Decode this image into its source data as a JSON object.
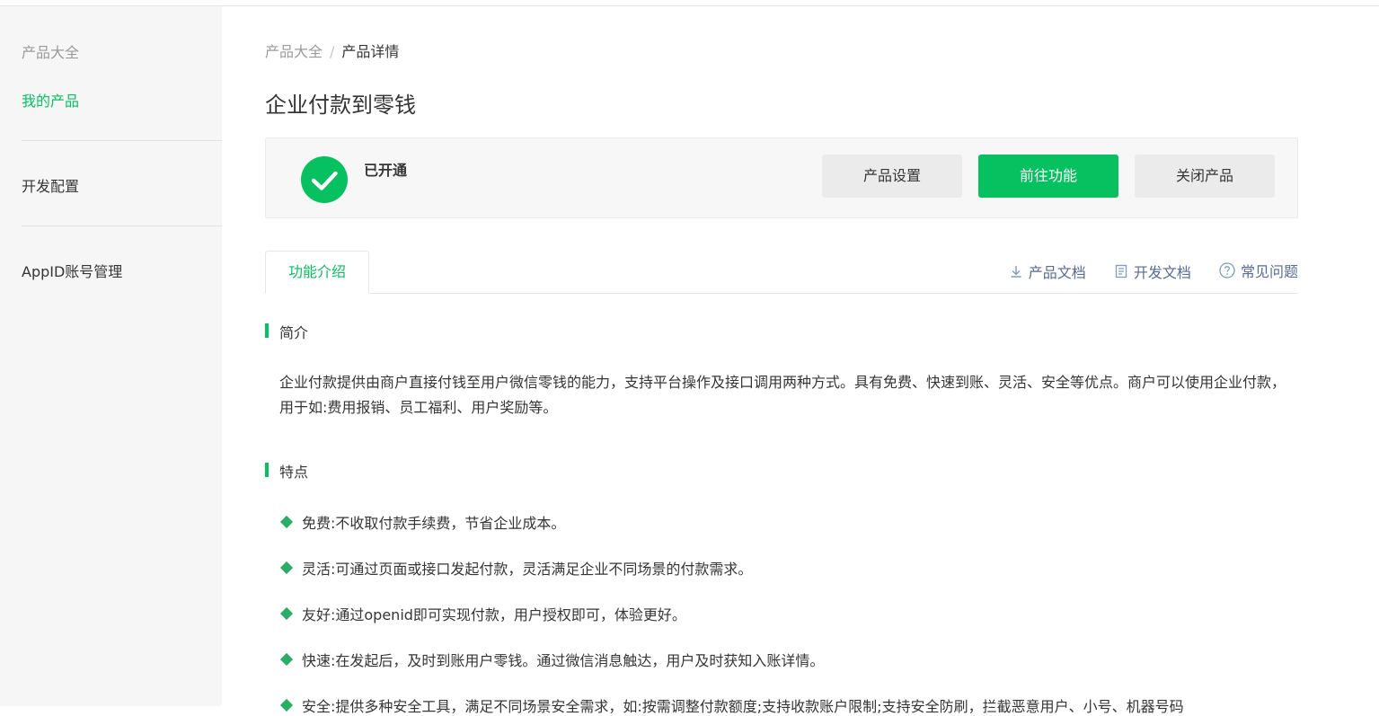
{
  "sidebar": {
    "category_label": "产品大全",
    "my_products": "我的产品",
    "dev_config": "开发配置",
    "appid_manage": "AppID账号管理"
  },
  "breadcrumb": {
    "root": "产品大全",
    "separator": "/",
    "current": "产品详情"
  },
  "page_title": "企业付款到零钱",
  "status": {
    "label": "已开通",
    "icon": "check-circle-icon",
    "buttons": {
      "settings": "产品设置",
      "goto": "前往功能",
      "close": "关闭产品"
    }
  },
  "tabs": [
    {
      "label": "功能介绍",
      "active": true
    }
  ],
  "doc_links": {
    "product_doc": "产品文档",
    "dev_doc": "开发文档",
    "faq": "常见问题"
  },
  "intro": {
    "heading": "简介",
    "text": "企业付款提供由商户直接付钱至用户微信零钱的能力，支持平台操作及接口调用两种方式。具有免费、快速到账、灵活、安全等优点。商户可以使用企业付款，用于如:费用报销、员工福利、用户奖励等。"
  },
  "features": {
    "heading": "特点",
    "items": [
      "免费:不收取付款手续费，节省企业成本。",
      "灵活:可通过页面或接口发起付款，灵活满足企业不同场景的付款需求。",
      "友好:通过openid即可实现付款，用户授权即可，体验更好。",
      "快速:在发起后，及时到账用户零钱。通过微信消息触达，用户及时获知入账详情。",
      "安全:提供多种安全工具，满足不同场景安全需求，如:按需调整付款额度;支持收款账户限制;支持安全防刷，拦截恶意用户、小号、机器号码"
    ]
  },
  "colors": {
    "brand_green": "#07c160",
    "link_blue": "#576b95",
    "sidebar_bg": "#f6f6f6"
  }
}
